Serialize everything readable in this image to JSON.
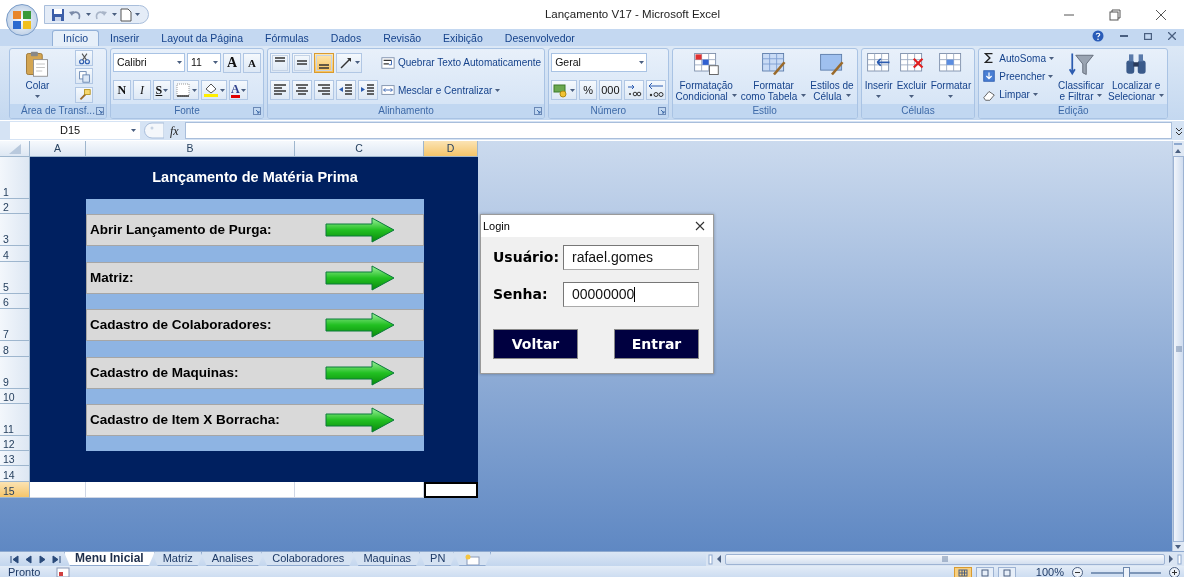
{
  "window": {
    "title": "Lançamento V17 - Microsoft Excel"
  },
  "ribbon": {
    "tabs": [
      {
        "label": "Início",
        "selected": true
      },
      {
        "label": "Inserir",
        "selected": false
      },
      {
        "label": "Layout da Página",
        "selected": false
      },
      {
        "label": "Fórmulas",
        "selected": false
      },
      {
        "label": "Dados",
        "selected": false
      },
      {
        "label": "Revisão",
        "selected": false
      },
      {
        "label": "Exibição",
        "selected": false
      },
      {
        "label": "Desenvolvedor",
        "selected": false
      }
    ],
    "groups": [
      {
        "label": "Área de Transf...",
        "launcher": true,
        "blocks": [
          {
            "kind": "large",
            "lines": [
              "Colar"
            ],
            "caret": true
          },
          {
            "kind": "stack",
            "rows": [
              {
                "controls": [
                  {
                    "kind": "icon"
                  }
                ]
              },
              {
                "controls": [
                  {
                    "kind": "icon"
                  }
                ]
              },
              {
                "controls": [
                  {
                    "kind": "icon"
                  }
                ]
              }
            ]
          }
        ]
      },
      {
        "label": "Fonte",
        "launcher": true,
        "blocks": [
          {
            "kind": "stack",
            "rows": [
              {
                "controls": [
                  {
                    "kind": "font-field",
                    "value": "Calibri"
                  },
                  {
                    "kind": "size-field",
                    "value": "11"
                  },
                  {
                    "kind": "grow",
                    "label": "A"
                  },
                  {
                    "kind": "shrink",
                    "label": "A"
                  }
                ]
              },
              {
                "controls": [
                  {
                    "kind": "bold",
                    "label": "N"
                  },
                  {
                    "kind": "italic",
                    "label": "I"
                  },
                  {
                    "kind": "underline",
                    "label": "S",
                    "caret": true
                  },
                  {
                    "kind": "icon",
                    "caret": true
                  },
                  {
                    "kind": "icon",
                    "caret": true
                  },
                  {
                    "kind": "color-text",
                    "label": "A",
                    "caret": true
                  }
                ]
              }
            ]
          }
        ]
      },
      {
        "label": "Alinhamento",
        "launcher": true,
        "blocks": [
          {
            "kind": "stack",
            "rows": [
              {
                "controls": [
                  {
                    "kind": "icon",
                    "on": false
                  },
                  {
                    "kind": "icon",
                    "on": false
                  },
                  {
                    "kind": "icon",
                    "on": true
                  },
                  {
                    "kind": "icon",
                    "on": false,
                    "caret": true
                  }
                ]
              },
              {
                "controls": [
                  {
                    "kind": "icon",
                    "on": false
                  },
                  {
                    "kind": "icon",
                    "on": false
                  },
                  {
                    "kind": "icon",
                    "on": false
                  },
                  {
                    "kind": "icon",
                    "on": false
                  },
                  {
                    "kind": "icon",
                    "on": false
                  }
                ]
              }
            ]
          },
          {
            "kind": "stack",
            "rows": [
              {
                "controls": [
                  {
                    "kind": "small",
                    "label": "Quebrar Texto Automaticamente"
                  }
                ]
              },
              {
                "controls": [
                  {
                    "kind": "small",
                    "label": "Mesclar e Centralizar",
                    "caret": true
                  }
                ]
              }
            ]
          }
        ]
      },
      {
        "label": "Número",
        "launcher": true,
        "blocks": [
          {
            "kind": "stack",
            "rows": [
              {
                "controls": [
                  {
                    "kind": "format-field",
                    "value": "Geral"
                  }
                ]
              },
              {
                "controls": [
                  {
                    "kind": "icon",
                    "caret": true
                  },
                  {
                    "kind": "text",
                    "label": "%"
                  },
                  {
                    "kind": "text",
                    "label": "000"
                  },
                  {
                    "kind": "icon"
                  },
                  {
                    "kind": "icon"
                  }
                ]
              }
            ]
          }
        ]
      },
      {
        "label": "Estilo",
        "launcher": false,
        "blocks": [
          {
            "kind": "large",
            "lines": [
              "Formatação",
              "Condicional"
            ],
            "caret": true
          },
          {
            "kind": "large",
            "lines": [
              "Formatar",
              "como Tabela"
            ],
            "caret": true
          },
          {
            "kind": "large",
            "lines": [
              "Estilos de",
              "Célula"
            ],
            "caret": true
          }
        ]
      },
      {
        "label": "Células",
        "launcher": false,
        "blocks": [
          {
            "kind": "large",
            "lines": [
              "Inserir"
            ],
            "caret": true
          },
          {
            "kind": "large",
            "lines": [
              "Excluir"
            ],
            "caret": true
          },
          {
            "kind": "large",
            "lines": [
              "Formatar"
            ],
            "caret": true
          }
        ]
      },
      {
        "label": "Edição",
        "launcher": false,
        "blocks": [
          {
            "kind": "stack",
            "rows": [
              {
                "controls": [
                  {
                    "kind": "small",
                    "label": "AutoSoma",
                    "caret": true
                  }
                ]
              },
              {
                "controls": [
                  {
                    "kind": "small",
                    "label": "Preencher",
                    "caret": true
                  }
                ]
              },
              {
                "controls": [
                  {
                    "kind": "small",
                    "label": "Limpar",
                    "caret": true
                  }
                ]
              }
            ]
          },
          {
            "kind": "large",
            "lines": [
              "Classificar",
              "e Filtrar"
            ],
            "caret": true
          },
          {
            "kind": "large",
            "lines": [
              "Localizar e",
              "Selecionar"
            ],
            "caret": true
          }
        ]
      }
    ]
  },
  "formula_bar": {
    "name_box": "D15",
    "function_label": "fx"
  },
  "sheet": {
    "columns": [
      {
        "label": "A",
        "selected": false
      },
      {
        "label": "B",
        "selected": false
      },
      {
        "label": "C",
        "selected": false
      },
      {
        "label": "D",
        "selected": true
      }
    ],
    "rows": [
      {
        "label": "1",
        "selected": false
      },
      {
        "label": "2",
        "selected": false
      },
      {
        "label": "3",
        "selected": false
      },
      {
        "label": "4",
        "selected": false
      },
      {
        "label": "5",
        "selected": false
      },
      {
        "label": "6",
        "selected": false
      },
      {
        "label": "7",
        "selected": false
      },
      {
        "label": "8",
        "selected": false
      },
      {
        "label": "9",
        "selected": false
      },
      {
        "label": "10",
        "selected": false
      },
      {
        "label": "11",
        "selected": false
      },
      {
        "label": "12",
        "selected": false
      },
      {
        "label": "13",
        "selected": false
      },
      {
        "label": "14",
        "selected": false
      },
      {
        "label": "15",
        "selected": true
      }
    ],
    "panel": {
      "title": "Lançamento de Matéria Prima",
      "items": [
        {
          "label": "Abrir Lançamento de Purga:"
        },
        {
          "label": "Matriz:"
        },
        {
          "label": "Cadastro de Colaboradores:"
        },
        {
          "label": "Cadastro de Maquinas:"
        },
        {
          "label": "Cadastro de Item X Borracha:"
        }
      ]
    }
  },
  "sheet_tabs": [
    {
      "label": "Menu Inicial",
      "selected": true
    },
    {
      "label": "Matriz",
      "selected": false
    },
    {
      "label": "Analises",
      "selected": false
    },
    {
      "label": "Colaboradores",
      "selected": false
    },
    {
      "label": "Maquinas",
      "selected": false
    },
    {
      "label": "PN",
      "selected": false
    }
  ],
  "status_bar": {
    "status": "Pronto",
    "views": [
      {
        "selected": true
      },
      {
        "selected": false
      },
      {
        "selected": false
      }
    ],
    "zoom": "100%",
    "zoom_slider": {
      "level": 0.5
    }
  },
  "login_dialog": {
    "title": "Login",
    "fields": [
      {
        "label": "Usuário:",
        "value": "rafael.gomes",
        "focused": false
      },
      {
        "label": "Senha:",
        "value": "00000000",
        "focused": true
      }
    ],
    "buttons": [
      "Voltar",
      "Entrar"
    ]
  }
}
